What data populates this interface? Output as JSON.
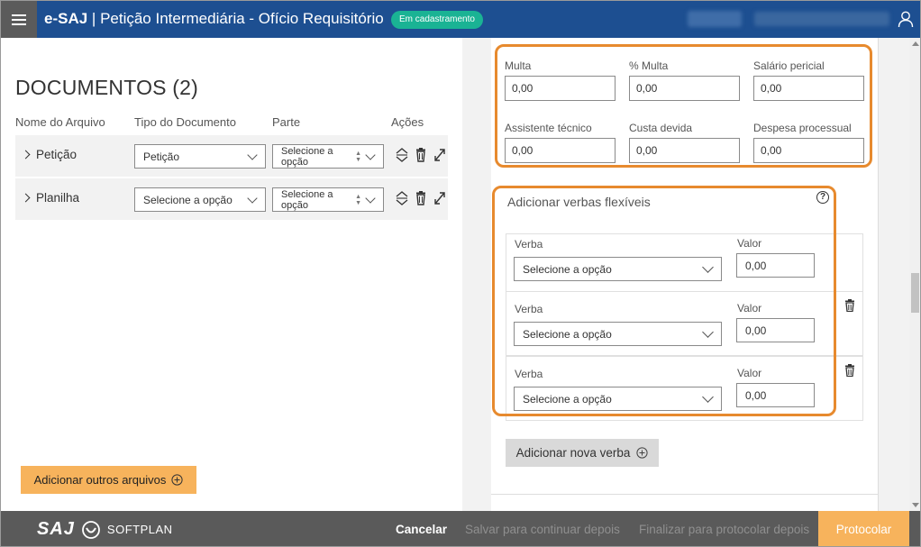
{
  "header": {
    "app_name": "e-SAJ",
    "separator": " | ",
    "page_title": "Petição Intermediária - Ofício Requisitório",
    "status": "Em cadastramento"
  },
  "documents": {
    "title": "DOCUMENTOS (2)",
    "columns": [
      "Nome do Arquivo",
      "Tipo do Documento",
      "Parte",
      "Ações"
    ],
    "rows": [
      {
        "name": "Petição",
        "type": "Petição",
        "party": "Selecione a opção"
      },
      {
        "name": "Planilha",
        "type": "Selecione a opção",
        "party": "Selecione a opção"
      }
    ],
    "add_files_label": "Adicionar outros arquivos"
  },
  "values_section": {
    "fields": [
      {
        "label": "Multa",
        "value": "0,00"
      },
      {
        "label": "% Multa",
        "value": "0,00"
      },
      {
        "label": "Salário pericial",
        "value": "0,00"
      },
      {
        "label": "Assistente técnico",
        "value": "0,00"
      },
      {
        "label": "Custa devida",
        "value": "0,00"
      },
      {
        "label": "Despesa processual",
        "value": "0,00"
      }
    ]
  },
  "flex_verbs": {
    "title": "Adicionar verbas flexíveis",
    "help": "?",
    "verba_label": "Verba",
    "valor_label": "Valor",
    "rows": [
      {
        "verba": "Selecione a opção",
        "valor": "0,00"
      },
      {
        "verba": "Selecione a opção",
        "valor": "0,00"
      },
      {
        "verba": "Selecione a opção",
        "valor": "0,00"
      }
    ],
    "add_label": "Adicionar nova verba"
  },
  "footer": {
    "brand_saj": "SAJ",
    "brand_softplan": "SOFTPLAN",
    "cancel": "Cancelar",
    "save_later": "Salvar para continuar depois",
    "finish_later": "Finalizar para protocolar depois",
    "submit": "Protocolar"
  },
  "colors": {
    "header_bg": "#1d4f91",
    "status_badge": "#1ab394",
    "accent_orange": "#f7b35c",
    "highlight_border": "#e78a2e",
    "footer_bg": "#5a5a5a"
  }
}
